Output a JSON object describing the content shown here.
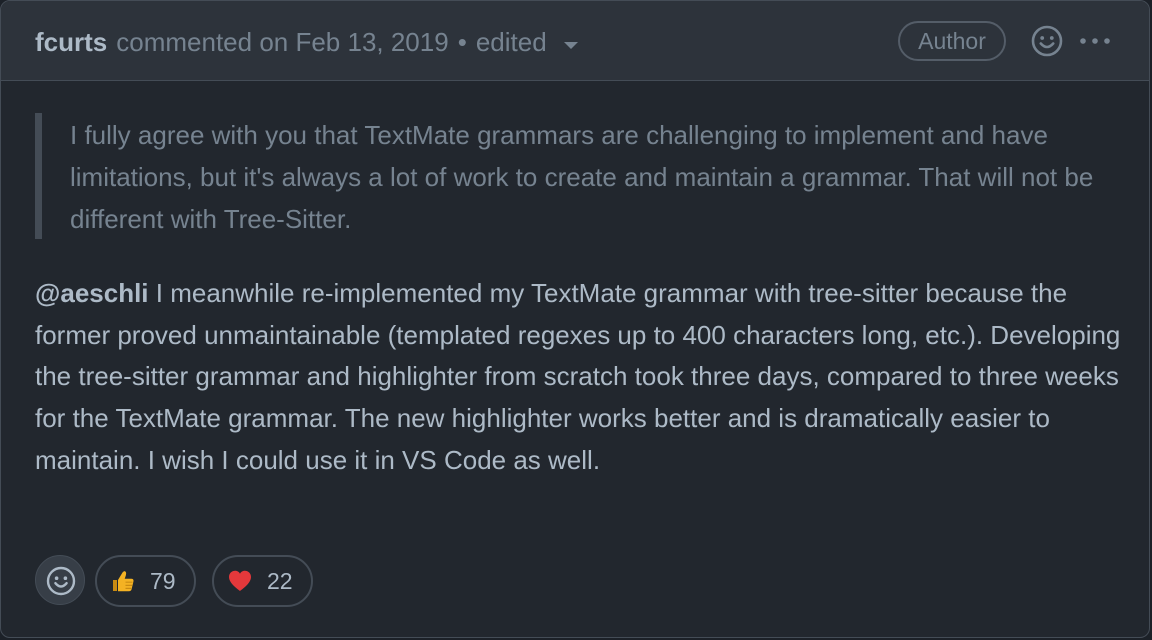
{
  "header": {
    "author": "fcurts",
    "action": "commented on Feb 13, 2019",
    "separator": "•",
    "edited": "edited",
    "badge": "Author",
    "icons": [
      "smiley-icon",
      "kebab-icon",
      "chevron-down-icon"
    ]
  },
  "quote": {
    "text": "I fully agree with you that TextMate grammars are challenging to implement and have limitations, but it's always a lot of work to create and maintain a grammar. That will not be different with Tree-Sitter."
  },
  "body": {
    "mention": "@aeschli",
    "text": " I meanwhile re-implemented my TextMate grammar with tree-sitter because the former proved unmaintainable (templated regexes up to 400 characters long, etc.). Developing the tree-sitter grammar and highlighter from scratch took three days, compared to three weeks for the TextMate grammar. The new highlighter works better and is dramatically easier to maintain. I wish I could use it in VS Code as well."
  },
  "reactions": [
    {
      "emoji": "thumbs-up-icon",
      "count": "79"
    },
    {
      "emoji": "heart-icon",
      "count": "22"
    }
  ],
  "colors": {
    "background": "#22272e",
    "header_bg": "#2d333b",
    "border": "#444c56",
    "muted_text": "#768390",
    "text": "#adbac7",
    "heart": "#e5383b",
    "thumb": "#f4b223"
  }
}
